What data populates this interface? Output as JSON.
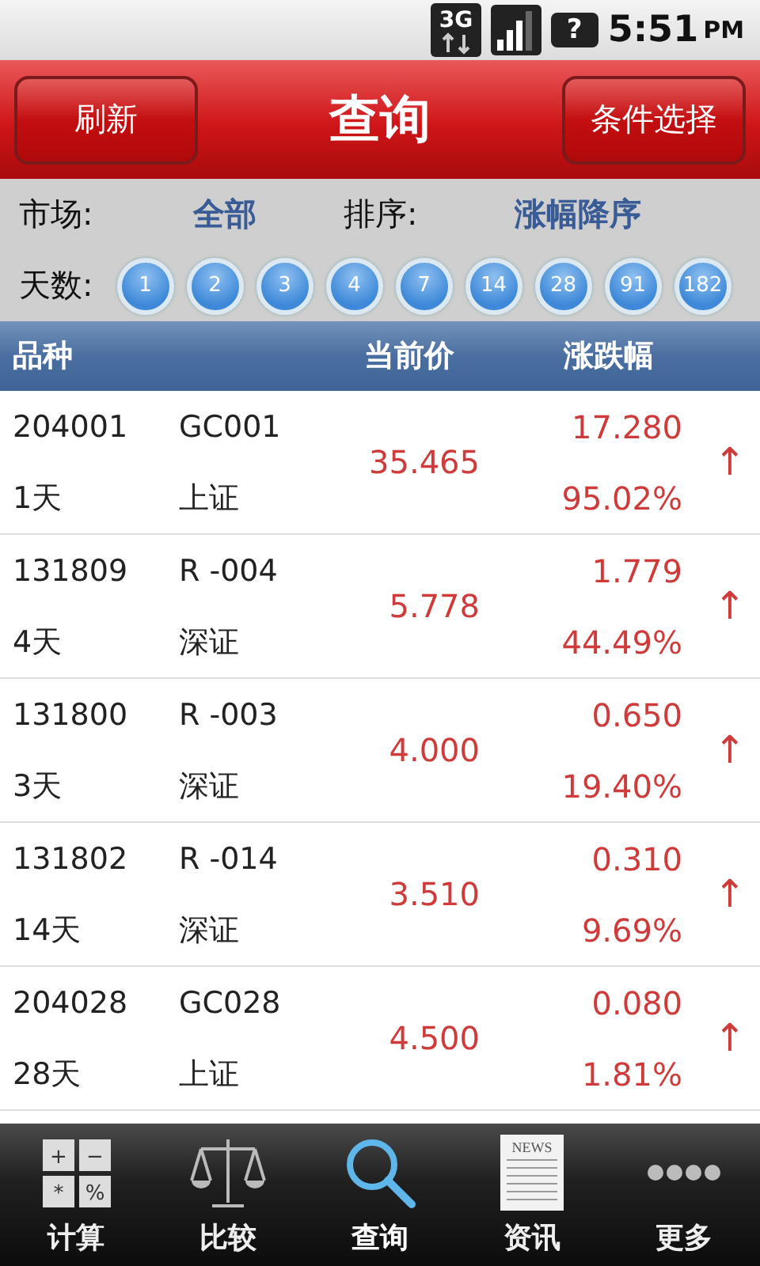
{
  "status_bar": {
    "network": "3G",
    "battery": "?",
    "time": "5:51",
    "ampm": "PM"
  },
  "header": {
    "left_button": "刷新",
    "title": "查询",
    "right_button": "条件选择"
  },
  "filters": {
    "market_label": "市场:",
    "market_value": "全部",
    "sort_label": "排序:",
    "sort_value": "涨幅降序",
    "days_label": "天数:",
    "days": [
      "1",
      "2",
      "3",
      "4",
      "7",
      "14",
      "28",
      "91",
      "182"
    ]
  },
  "table": {
    "columns": [
      "品种",
      "当前价",
      "涨跌幅"
    ],
    "rows": [
      {
        "code": "204001",
        "name": "GC001",
        "term": "1天",
        "market": "上证",
        "price": "35.465",
        "change": "17.280",
        "percent": "95.02%",
        "arrow": "↑"
      },
      {
        "code": "131809",
        "name": "R -004",
        "term": "4天",
        "market": "深证",
        "price": "5.778",
        "change": "1.779",
        "percent": "44.49%",
        "arrow": "↑"
      },
      {
        "code": "131800",
        "name": "R -003",
        "term": "3天",
        "market": "深证",
        "price": "4.000",
        "change": "0.650",
        "percent": "19.40%",
        "arrow": "↑"
      },
      {
        "code": "131802",
        "name": "R -014",
        "term": "14天",
        "market": "深证",
        "price": "3.510",
        "change": "0.310",
        "percent": "9.69%",
        "arrow": "↑"
      },
      {
        "code": "204028",
        "name": "GC028",
        "term": "28天",
        "market": "上证",
        "price": "4.500",
        "change": "0.080",
        "percent": "1.81%",
        "arrow": "↑"
      }
    ]
  },
  "tab_bar": [
    {
      "label": "计算",
      "kind": "calculator",
      "icon_text": [
        "+",
        "−",
        "*",
        "%"
      ],
      "selected": false
    },
    {
      "label": "比较",
      "kind": "scale",
      "selected": false
    },
    {
      "label": "查询",
      "kind": "search",
      "selected": true
    },
    {
      "label": "资讯",
      "kind": "news",
      "icon_text": [
        "NEWS"
      ],
      "selected": false
    },
    {
      "label": "更多",
      "kind": "more",
      "selected": false
    }
  ]
}
